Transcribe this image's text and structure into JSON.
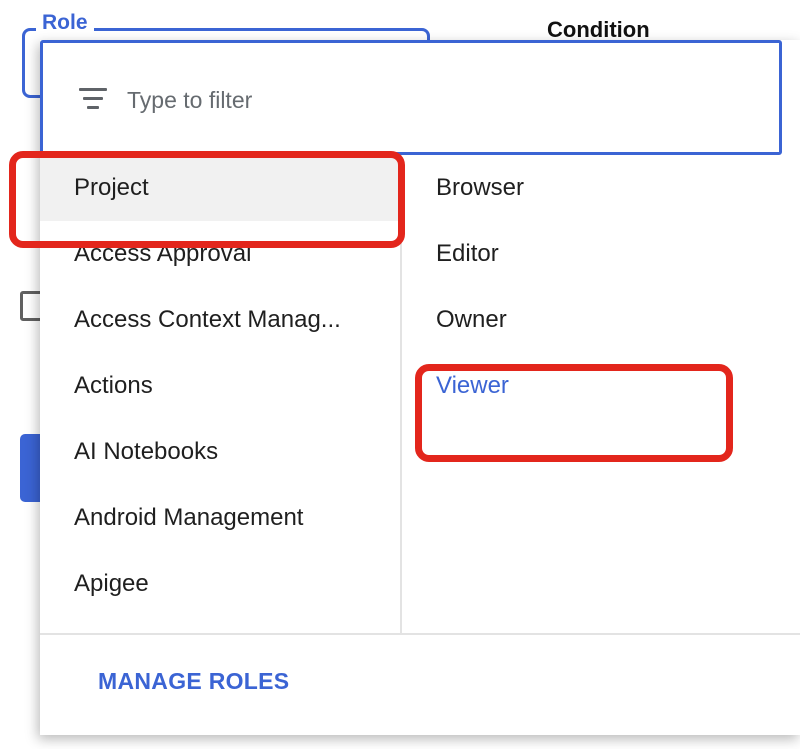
{
  "background_form": {
    "role_label": "Role",
    "condition_label": "Condition"
  },
  "dropdown": {
    "filter": {
      "icon": "filter-list-icon",
      "placeholder": "Type to filter",
      "value": ""
    },
    "services": [
      {
        "label": "Project",
        "selected": true
      },
      {
        "label": "Access Approval",
        "selected": false
      },
      {
        "label": "Access Context Manag...",
        "selected": false
      },
      {
        "label": "Actions",
        "selected": false
      },
      {
        "label": "AI Notebooks",
        "selected": false
      },
      {
        "label": "Android Management",
        "selected": false
      },
      {
        "label": "Apigee",
        "selected": false
      }
    ],
    "roles": [
      {
        "label": "Browser",
        "active": false
      },
      {
        "label": "Editor",
        "active": false
      },
      {
        "label": "Owner",
        "active": false
      },
      {
        "label": "Viewer",
        "active": true
      }
    ],
    "footer": {
      "manage_roles_label": "MANAGE ROLES"
    }
  },
  "annotations": {
    "highlight_color": "#e3261c",
    "highlighted_items": [
      "Project",
      "Viewer"
    ]
  },
  "colors": {
    "accent": "#3b64d4",
    "text": "#1f1f1f",
    "selected_background": "#f1f1f1"
  }
}
